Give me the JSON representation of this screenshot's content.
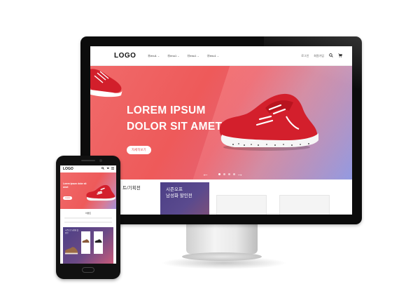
{
  "desktop": {
    "logo": "LOGO",
    "menu": [
      {
        "label": "Ⓜenu1"
      },
      {
        "label": "Ⓜenu1"
      },
      {
        "label": "Ⓜenu1"
      },
      {
        "label": "Ⓜenu1"
      }
    ],
    "menu_caret": "⌄",
    "util_links": {
      "login": "로그인",
      "join": "회원가입"
    },
    "icons": {
      "search": "search-icon",
      "cart": "cart-icon"
    },
    "hero": {
      "title_line1": "LOREM IPSUM",
      "title_line2": "DOLOR SIT AMET",
      "button": "자세히보기",
      "prev": "←",
      "next": "→",
      "slide_count": 4,
      "active_slide": 1
    },
    "section_label": "트/기획전",
    "promo": {
      "line1": "시즌오프",
      "line2": "남성화 할인전"
    }
  },
  "mobile": {
    "logo": "LOGO",
    "icons": {
      "search": "search-icon",
      "cart": "cart-icon",
      "menu": "menu-icon"
    },
    "hero": {
      "title": "Lorem ipsum dolor sit amet",
      "button": "자세히"
    },
    "section_title": "이벤트",
    "promo": {
      "text": "시즌오프 남성화 할인전"
    }
  },
  "colors": {
    "brand_red": "#ee5a5a",
    "promo_purple": "#4c3f86",
    "hero_blue": "#8f9ae4"
  }
}
